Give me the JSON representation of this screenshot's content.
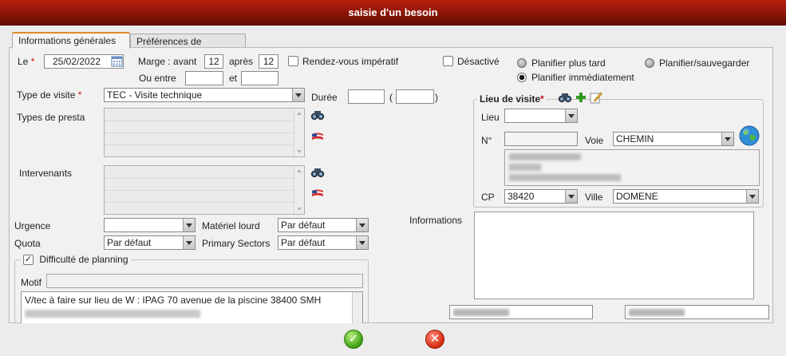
{
  "window": {
    "title": "saisie d'un besoin"
  },
  "tabs": [
    {
      "label": "Informations générales"
    },
    {
      "label": "Préférences de passage"
    }
  ],
  "form": {
    "le_label": "Le",
    "date_value": "25/02/2022",
    "marge_label": "Marge : avant",
    "marge_avant": "12",
    "apres_label": "après",
    "marge_apres": "12",
    "ou_entre_label": "Ou entre",
    "et_label": "et",
    "rdv_label": "Rendez-vous impératif",
    "desactive_label": "Désactivé",
    "planifier_plus_tard": "Planifier plus tard",
    "planifier_sauvegarder": "Planifier/sauvegarder",
    "planifier_immediatement": "Planifier immédiatement",
    "type_visite_label": "Type de visite",
    "type_visite_value": "TEC - Visite technique",
    "duree_label": "Durée",
    "paren_open": "(",
    "paren_close": ")",
    "types_presta_label": "Types de presta",
    "intervenants_label": "Intervenants",
    "urgence_label": "Urgence",
    "urgence_value": "",
    "materiel_lourd_label": "Matériel lourd",
    "materiel_lourd_value": "Par défaut",
    "quota_label": "Quota",
    "quota_value": "Par défaut",
    "primary_sectors_label": "Primary Sectors",
    "primary_sectors_value": "Par défaut",
    "difficulte_label": "Difficulté de planning",
    "motif_label": "Motif",
    "difficulte_text": "V/tec à faire sur lieu de W : IPAG 70 avenue de la piscine 38400 SMH",
    "informations_label": "Informations"
  },
  "lieu_visite": {
    "title": "Lieu de visite",
    "lieu_label": "Lieu",
    "lieu_value": "",
    "no_label": "N°",
    "voie_label": "Voie",
    "voie_value": "CHEMIN",
    "cp_label": "CP",
    "cp_value": "38420",
    "ville_label": "Ville",
    "ville_value": "DOMENE"
  },
  "icons": {
    "search": "binoculars-icon",
    "flag": "flag-icon",
    "add": "plus-icon",
    "edit": "edit-icon",
    "globe": "globe-icon",
    "calendar": "calendar-icon"
  },
  "colors": {
    "title_bar": "#8a1408",
    "accent_tab": "#e08a2c",
    "required": "#d01010",
    "ok": "#3e9e12",
    "cancel": "#d62a12"
  }
}
